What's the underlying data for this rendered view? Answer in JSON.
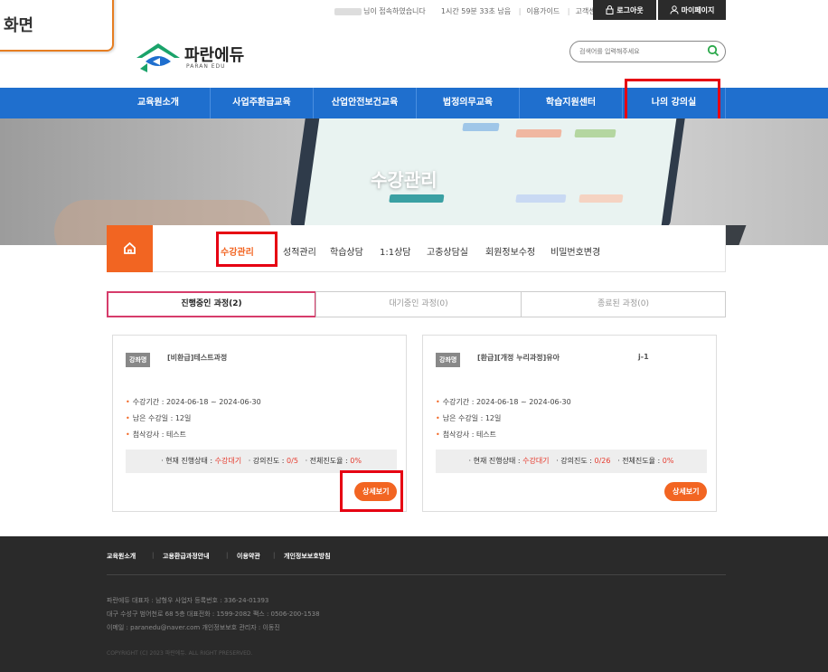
{
  "callout": {
    "text": "화면"
  },
  "topbar": {
    "session": "님이 접속하였습니다",
    "remain": "1시간 59분 33초 남음",
    "guide": "이용가이드",
    "support": "고객센터",
    "logout": "로그아웃",
    "mypage": "마이페이지"
  },
  "logo": {
    "name": "파란에듀",
    "sub": "PARAN EDU"
  },
  "search": {
    "placeholder": "검색어를 입력해주세요"
  },
  "nav": [
    "교육원소개",
    "사업주환급교육",
    "산업안전보건교육",
    "법정의무교육",
    "학습지원센터",
    "나의 강의실"
  ],
  "banner": {
    "title": "수강관리"
  },
  "submenu": [
    "수강관리",
    "성적관리",
    "학습상담",
    "1:1상담",
    "고충상담실",
    "회원정보수정",
    "비밀번호변경"
  ],
  "tabs": [
    "진행중인 과정(2)",
    "대기중인 과정(0)",
    "종료된 과정(0)"
  ],
  "cards": [
    {
      "badge": "강좌명",
      "title": "[비환급]테스트과정",
      "period": "수강기간 : 2024-06-18 ~ 2024-06-30",
      "remain": "남은 수강일 : 12일",
      "teacher": "첨삭강사 : 테스트",
      "status_label": "· 현재 진행상태 : ",
      "status": "수강대기",
      "progress_label": "· 강의진도 : ",
      "progress": "0/5",
      "total_label": "· 전체진도율 : ",
      "total": "0%",
      "button": "상세보기"
    },
    {
      "badge": "강좌명",
      "title": "[환급][개정 누리과정]유아",
      "suffix": "j-1",
      "period": "수강기간 : 2024-06-18 ~ 2024-06-30",
      "remain": "남은 수강일 : 12일",
      "teacher": "첨삭강사 : 테스트",
      "status_label": "· 현재 진행상태 : ",
      "status": "수강대기",
      "progress_label": "· 강의진도 : ",
      "progress": "0/26",
      "total_label": "· 전체진도율 : ",
      "total": "0%",
      "button": "상세보기"
    }
  ],
  "footer": {
    "links": [
      "교육원소개",
      "고용환급과정안내",
      "이용약관",
      "개인정보보호방침"
    ],
    "line1": "파란에듀     대표자 : 남형우     사업자 등록번호 : 336-24-01393",
    "line2": "대구 수성구 범어천로 68 5층     대표전화 : 1599-2082     팩스 : 0506-200-1538",
    "line3": "이메일 : paranedu@naver.com     개인정보보호 관리자 : 이동진",
    "copyright": "COPYRIGHT (C) 2023 파란에듀. ALL RIGHT PRESERVED."
  },
  "colors": {
    "nav": "#1f6fce",
    "accent": "#f26522",
    "highlight": "#e60012",
    "tab_active": "#d63c6b"
  }
}
